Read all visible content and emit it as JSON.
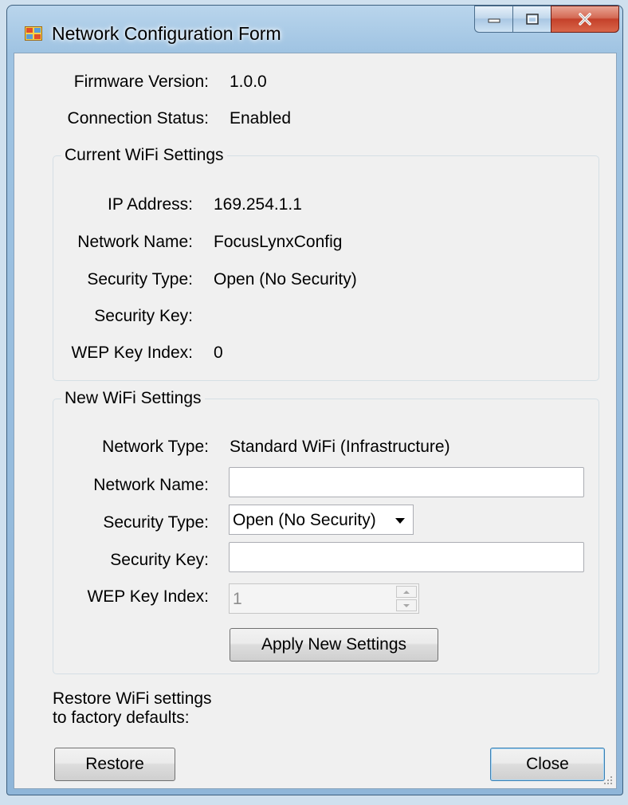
{
  "window": {
    "title": "Network Configuration Form",
    "icon": "app-form-icon",
    "controls": [
      "minimize-icon",
      "maximize-icon",
      "close-icon"
    ]
  },
  "status": {
    "firmware_label": "Firmware Version:",
    "firmware_value": "1.0.0",
    "connection_label": "Connection Status:",
    "connection_value": "Enabled"
  },
  "current": {
    "legend": "Current WiFi Settings",
    "ip_label": "IP Address:",
    "ip_value": "169.254.1.1",
    "name_label": "Network Name:",
    "name_value": "FocusLynxConfig",
    "security_label": "Security Type:",
    "security_value": "Open (No Security)",
    "key_label": "Security Key:",
    "key_value": "",
    "wep_label": "WEP Key Index:",
    "wep_value": "0"
  },
  "new": {
    "legend": "New WiFi Settings",
    "type_label": "Network Type:",
    "type_value": "Standard WiFi (Infrastructure)",
    "name_label": "Network Name:",
    "name_value": "",
    "security_label": "Security Type:",
    "security_selected": "Open (No Security)",
    "key_label": "Security Key:",
    "key_value": "",
    "wep_label": "WEP Key Index:",
    "wep_value": "1",
    "apply_button": "Apply New Settings"
  },
  "footer": {
    "restore_line1": "Restore WiFi settings",
    "restore_line2": "to factory defaults:",
    "restore_button": "Restore",
    "close_button": "Close"
  }
}
